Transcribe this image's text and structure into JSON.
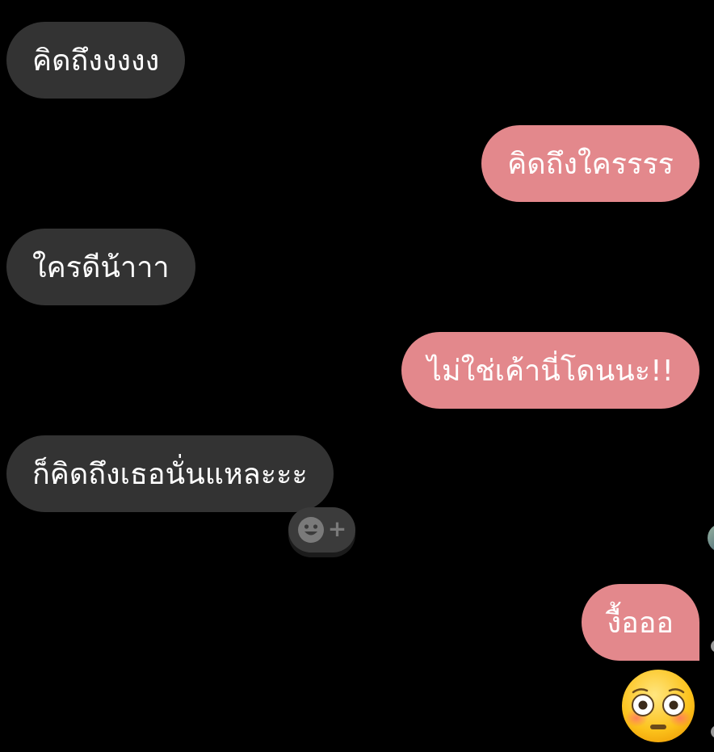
{
  "messages": [
    {
      "text": "คิดถึงงงงง",
      "sender": "other"
    },
    {
      "text": "คิดถึงใครรรร",
      "sender": "me"
    },
    {
      "text": "ใครดีน้าาา",
      "sender": "other"
    },
    {
      "text": "ไม่ใช่เค้านี่โดนนะ!!",
      "sender": "me"
    },
    {
      "text": "ก็คิดถึงเธอนั่นแหละะะ",
      "sender": "other"
    },
    {
      "text": "งื้อออ",
      "sender": "me"
    }
  ],
  "reaction_button": {
    "icon": "smiley-add-icon",
    "plus": "+"
  },
  "sticker": {
    "icon": "flushed-face-emoji"
  },
  "colors": {
    "background": "#000000",
    "incoming_bubble": "#333333",
    "outgoing_bubble": "#e3888c",
    "text": "#ffffff"
  }
}
